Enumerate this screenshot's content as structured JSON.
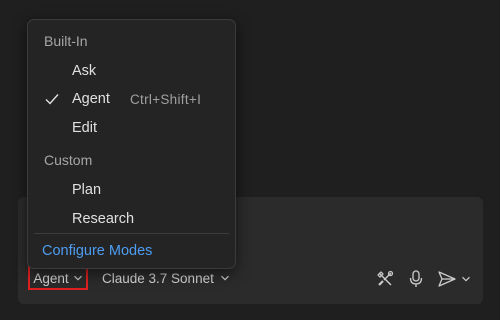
{
  "menu": {
    "builtin_header": "Built-In",
    "builtin_items": [
      {
        "label": "Ask",
        "checked": false,
        "keybinding": ""
      },
      {
        "label": "Agent",
        "checked": true,
        "keybinding": "Ctrl+Shift+I"
      },
      {
        "label": "Edit",
        "checked": false,
        "keybinding": ""
      }
    ],
    "custom_header": "Custom",
    "custom_items": [
      {
        "label": "Plan"
      },
      {
        "label": "Research"
      }
    ],
    "configure_label": "Configure Modes"
  },
  "toolbar": {
    "mode_label": "Agent",
    "model_label": "Claude 3.7 Sonnet",
    "icons": [
      "tools-icon",
      "microphone-icon",
      "send-icon",
      "chevron-down-icon"
    ]
  },
  "colors": {
    "background": "#1f1f1f",
    "panel": "#2b2b2b",
    "menu_bg": "#242424",
    "link": "#4d9df2",
    "highlight_border": "#e02020"
  }
}
